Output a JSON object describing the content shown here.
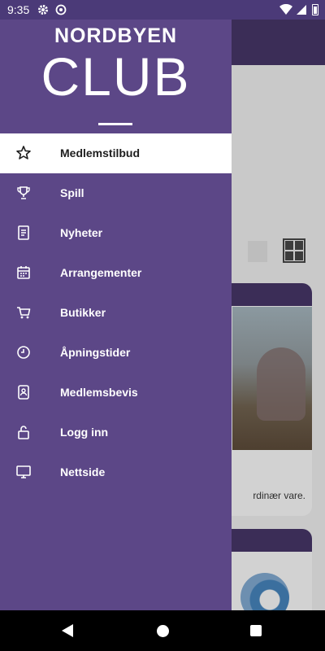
{
  "status_bar": {
    "time": "9:35",
    "icons": [
      "gear-icon",
      "at-sign-icon",
      "wifi-icon",
      "signal-icon",
      "battery-icon"
    ]
  },
  "drawer": {
    "brand_top": "NORDBYEN",
    "brand_main": "CLUB",
    "menu": [
      {
        "label": "Medlemstilbud",
        "icon": "star-icon",
        "active": true
      },
      {
        "label": "Spill",
        "icon": "trophy-icon",
        "active": false
      },
      {
        "label": "Nyheter",
        "icon": "document-icon",
        "active": false
      },
      {
        "label": "Arrangementer",
        "icon": "calendar-icon",
        "active": false
      },
      {
        "label": "Butikker",
        "icon": "cart-icon",
        "active": false
      },
      {
        "label": "Åpningstider",
        "icon": "clock-icon",
        "active": false
      },
      {
        "label": "Medlemsbevis",
        "icon": "badge-icon",
        "active": false
      },
      {
        "label": "Logg inn",
        "icon": "lock-icon",
        "active": false
      },
      {
        "label": "Nettside",
        "icon": "monitor-icon",
        "active": false
      }
    ]
  },
  "background_app": {
    "card1_caption": "rdinær vare."
  },
  "colors": {
    "drawer": "#5c4787",
    "status_bar": "#4b3a78",
    "app_header": "#3b2d57",
    "active_item_bg": "#ffffff"
  }
}
